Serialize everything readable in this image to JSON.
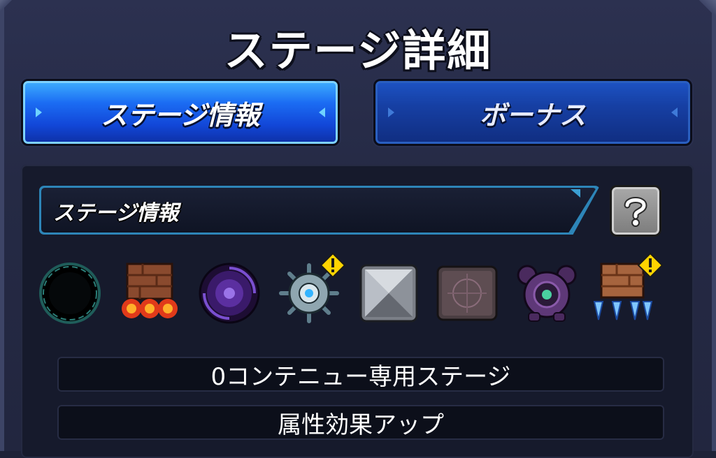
{
  "title": "ステージ詳細",
  "tabs": [
    {
      "label": "ステージ情報",
      "active": true
    },
    {
      "label": "ボーナス",
      "active": false
    }
  ],
  "section": {
    "label": "ステージ情報",
    "help_icon": "help-icon"
  },
  "gimmicks": [
    {
      "icon": "black-hole-icon"
    },
    {
      "icon": "damage-wall-icon"
    },
    {
      "icon": "warp-icon"
    },
    {
      "icon": "mine-icon",
      "warning": true
    },
    {
      "icon": "block-icon"
    },
    {
      "icon": "panel-icon"
    },
    {
      "icon": "shield-icon"
    },
    {
      "icon": "speed-down-wall-icon",
      "warning": true
    }
  ],
  "info_rows": [
    "0コンテニュー専用ステージ",
    "属性効果アップ"
  ],
  "colors": {
    "background": "#22263f",
    "tab_active": "#1b6cf3",
    "tab_inactive": "#163fa3",
    "panel": "#161a2c",
    "warning": "#ffd400"
  }
}
